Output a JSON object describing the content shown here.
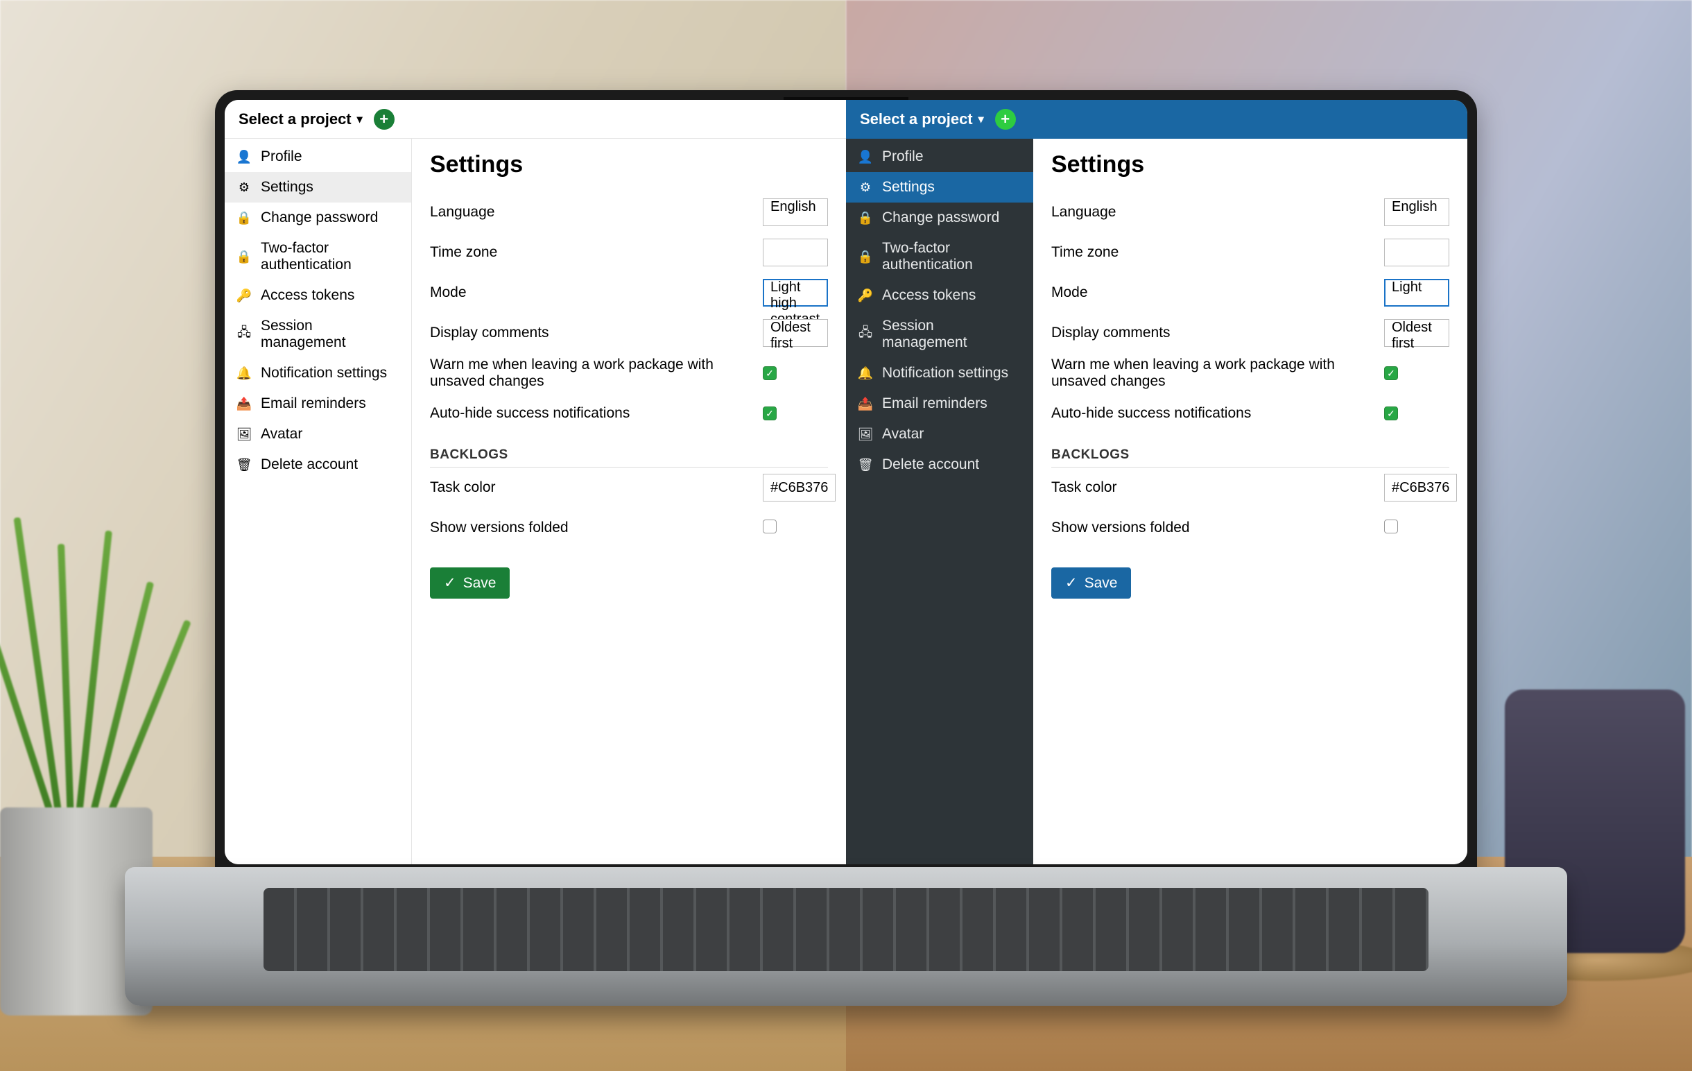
{
  "topbar": {
    "project_selector": "Select a project",
    "caret": "▾"
  },
  "sidebar": {
    "items": [
      {
        "icon": "person-icon",
        "glyph": "👤",
        "label": "Profile"
      },
      {
        "icon": "settings-icon",
        "glyph": "⚙",
        "label": "Settings",
        "active": true
      },
      {
        "icon": "lock-icon",
        "glyph": "🔒",
        "label": "Change password"
      },
      {
        "icon": "lock-icon",
        "glyph": "🔒",
        "label": "Two-factor authentication"
      },
      {
        "icon": "key-icon",
        "glyph": "🔑",
        "label": "Access tokens"
      },
      {
        "icon": "session-icon",
        "glyph": "🖧",
        "label": "Session management"
      },
      {
        "icon": "bell-icon",
        "glyph": "🔔",
        "label": "Notification settings"
      },
      {
        "icon": "mail-icon",
        "glyph": "📤",
        "label": "Email reminders"
      },
      {
        "icon": "avatar-icon",
        "glyph": "🖼",
        "label": "Avatar"
      },
      {
        "icon": "trash-icon",
        "glyph": "🗑",
        "label": "Delete account"
      }
    ]
  },
  "page": {
    "title": "Settings"
  },
  "form": {
    "labels": {
      "language": "Language",
      "timezone": "Time zone",
      "mode": "Mode",
      "display_comments": "Display comments",
      "warn_unsaved": "Warn me when leaving a work package with unsaved changes",
      "autohide": "Auto-hide success notifications",
      "backlogs_header": "BACKLOGS",
      "task_color": "Task color",
      "show_versions_folded": "Show versions folded"
    },
    "values_light": {
      "language": "English",
      "timezone": "",
      "mode": "Light high contrast",
      "display_comments": "Oldest first",
      "warn_unsaved_checked": true,
      "autohide_checked": true,
      "task_color": "#C6B376",
      "show_versions_folded_checked": false
    },
    "values_dark": {
      "language": "English",
      "timezone": "",
      "mode": "Light",
      "display_comments": "Oldest first",
      "warn_unsaved_checked": true,
      "autohide_checked": true,
      "task_color": "#C6B376",
      "show_versions_folded_checked": false
    },
    "save_label": "Save"
  }
}
